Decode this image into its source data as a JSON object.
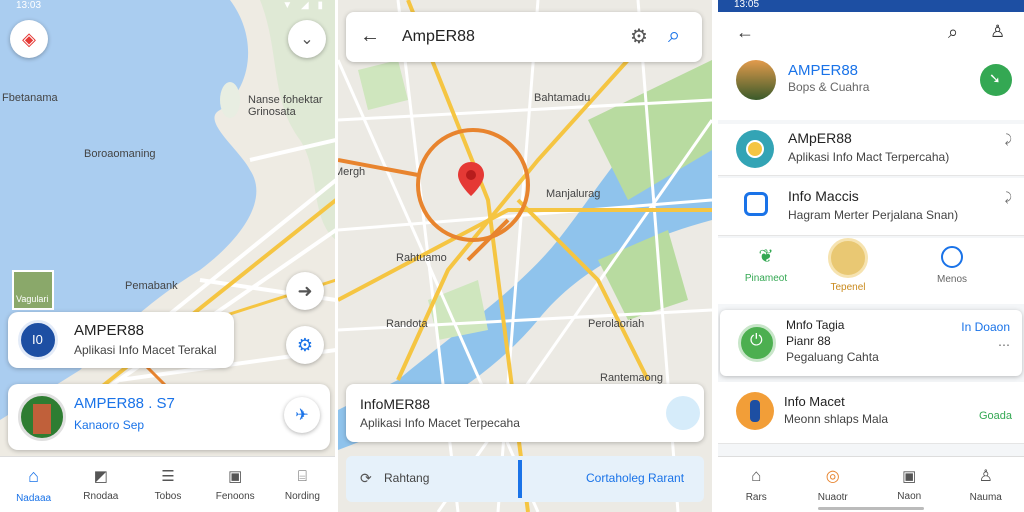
{
  "left": {
    "status_time": "13:03",
    "status_icons": "▼ ◢ ▮",
    "map_labels": [
      "Fbetanama",
      "Nanse fohektar Grinosata",
      "Boroaomaning",
      "Pemabank",
      "Vagulari"
    ],
    "card1": {
      "title": "AMPER88",
      "subtitle": "Aplikasi Info Macet Terakal"
    },
    "card2": {
      "title": "AMPER88 . S7",
      "subtitle": "Kanaoro Sep"
    },
    "nav": [
      "Nadaaa",
      "Rnodaa",
      "Tobos",
      "Fenoons",
      "Nording"
    ]
  },
  "middle": {
    "search_title": "AmpER88",
    "map_labels": [
      "Bahtamadu",
      "Mergh",
      "Manjalurag",
      "Rahtuamo",
      "Randota",
      "Perolaoriah",
      "Rantemaong"
    ],
    "card": {
      "title": "InfoMER88",
      "subtitle": "Aplikasi Info Macet Terpecaha"
    },
    "bar": {
      "left": "Rahtang",
      "right": "Cortaholeg Rarant"
    }
  },
  "right": {
    "status_time": "13:05",
    "header_card": {
      "title": "AMPER88",
      "subtitle": "Bops & Cuahra"
    },
    "row1": {
      "title": "AMpER88",
      "subtitle": "Aplikasi Info Mact Terpercaha)"
    },
    "row2": {
      "title": "Info Maccis",
      "subtitle": "Hagram Merter Perjalana Snan)"
    },
    "actions": [
      "Pinameot",
      "Tepenel",
      "Menos"
    ],
    "row3": {
      "title": "Mnfo Tagia",
      "line2": "Pianr 88",
      "subtitle": "Pegaluang Cahta",
      "right": "In Doaon"
    },
    "row4": {
      "title": "Info Macet",
      "subtitle": "Meonn shlaps Mala",
      "right": "Goada"
    },
    "nav": [
      "Rars",
      "Nuaotr",
      "Naon",
      "Nauma"
    ]
  },
  "colors": {
    "blue": "#1a73e8",
    "green": "#34a853",
    "red": "#e53935",
    "orange": "#f29e38"
  }
}
